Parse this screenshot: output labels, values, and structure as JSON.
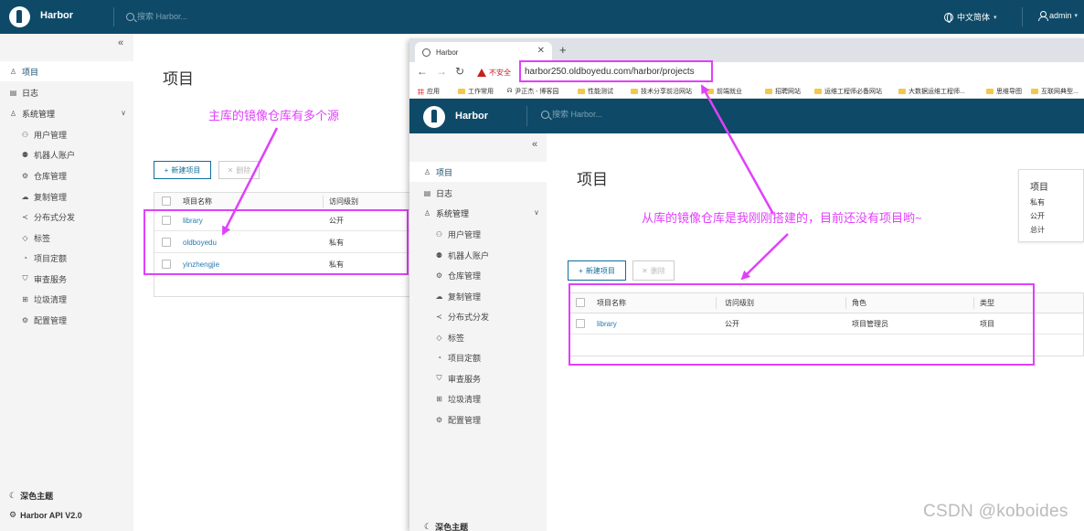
{
  "main": {
    "brand": "Harbor",
    "search_placeholder": "搜索 Harbor...",
    "language": "中文简体",
    "user": "admin",
    "sidebar": {
      "items": [
        {
          "label": "项目",
          "icon": "projects-icon"
        },
        {
          "label": "日志",
          "icon": "logs-icon"
        },
        {
          "label": "系统管理",
          "icon": "admin-icon"
        },
        {
          "label": "用户管理",
          "icon": "users-icon"
        },
        {
          "label": "机器人账户",
          "icon": "robot-icon"
        },
        {
          "label": "仓库管理",
          "icon": "registry-icon"
        },
        {
          "label": "复制管理",
          "icon": "replication-icon"
        },
        {
          "label": "分布式分发",
          "icon": "distribution-icon"
        },
        {
          "label": "标签",
          "icon": "tag-icon"
        },
        {
          "label": "项目定额",
          "icon": "quota-icon"
        },
        {
          "label": "审查服务",
          "icon": "shield-icon"
        },
        {
          "label": "垃圾清理",
          "icon": "trash-icon"
        },
        {
          "label": "配置管理",
          "icon": "gear-icon"
        }
      ],
      "dark_theme": "深色主题",
      "api": "Harbor API V2.0"
    },
    "page_title": "项目",
    "new_project": "新建项目",
    "delete": "删除",
    "columns": [
      "项目名称",
      "访问级别"
    ],
    "rows": [
      {
        "name": "library",
        "access": "公开"
      },
      {
        "name": "oldboyedu",
        "access": "私有"
      },
      {
        "name": "yinzhengjie",
        "access": "私有"
      }
    ],
    "annotation": "主库的镜像仓库有多个源"
  },
  "browser": {
    "tab_title": "Harbor",
    "insecure": "不安全",
    "url": "harbor250.oldboyedu.com/harbor/projects",
    "bookmarks": [
      "应用",
      "工作常用",
      "尹正杰 - 博客园",
      "性能测试",
      "技术分享前沿网站",
      "前端就业",
      "招聘网站",
      "运维工程师必备网站",
      "大数据运维工程师...",
      "思维导图",
      "互联网典型..."
    ],
    "brand": "Harbor",
    "search_placeholder": "搜索 Harbor...",
    "page_title": "项目",
    "new_project": "新建项目",
    "delete": "删除",
    "summary": {
      "title": "项目",
      "private": "私有",
      "public": "公开",
      "total": "总计"
    },
    "columns": [
      "项目名称",
      "访问级别",
      "角色",
      "类型"
    ],
    "rows": [
      {
        "name": "library",
        "access": "公开",
        "role": "项目管理员",
        "type": "项目"
      }
    ],
    "annotation": "从库的镜像仓库是我刚刚搭建的，目前还没有项目哟~"
  },
  "watermark": "CSDN @koboides",
  "colors": {
    "header": "#0e4a67",
    "accent": "#e040fb",
    "link": "#2a7bb0"
  }
}
